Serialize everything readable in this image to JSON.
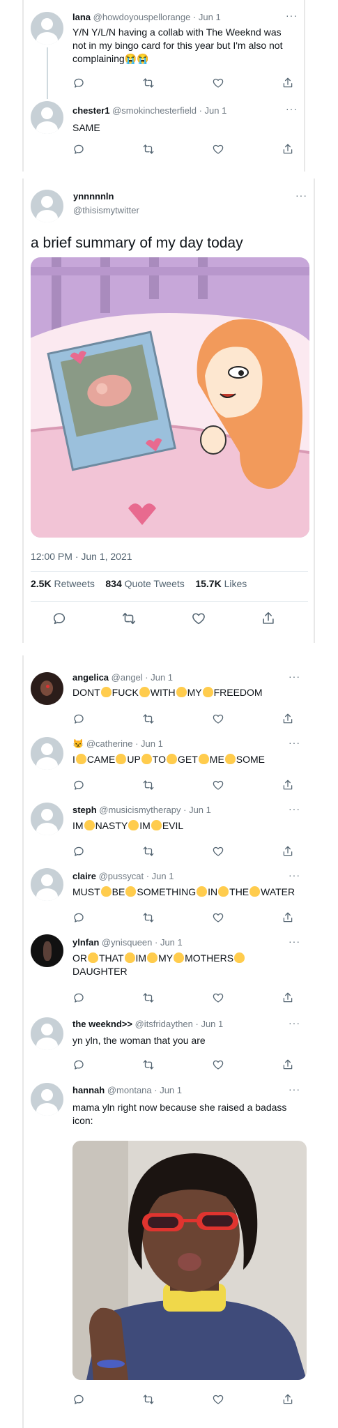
{
  "top_thread": {
    "tweet1": {
      "name": "lana",
      "handle": "@howdoyouspellorange · Jun 1",
      "text": "Y/N Y/L/N having a collab with The Weeknd was not in my bingo card for this year but I'm also not complaining😭😭"
    },
    "tweet2": {
      "name": "chester1",
      "handle": "@smokinchesterfield · Jun 1",
      "text": "SAME"
    }
  },
  "main_tweet": {
    "name": "ynnnnnln",
    "handle": "@thisismytwitter",
    "text": "a brief summary of my day today",
    "timestamp": "12:00 PM · Jun 1, 2021",
    "stats": {
      "retweets_num": "2.5K",
      "retweets_lbl": "Retweets",
      "quotes_num": "834",
      "quotes_lbl": "Quote Tweets",
      "likes_num": "15.7K",
      "likes_lbl": "Likes"
    }
  },
  "replies": [
    {
      "name": "angelica",
      "handle": "@angel · Jun 1",
      "words": [
        "DONT",
        "FUCK",
        "WITH",
        "MY",
        "FREEDOM"
      ]
    },
    {
      "name": "😾",
      "handle": "@catherine · Jun 1",
      "words": [
        "I",
        "CAME",
        "UP",
        "TO",
        "GET",
        "ME",
        "SOME"
      ]
    },
    {
      "name": "steph",
      "handle": "@musicismytherapy · Jun 1",
      "words": [
        "IM",
        "NASTY",
        "IM",
        "EVIL"
      ]
    },
    {
      "name": "claire",
      "handle": "@pussycat · Jun 1",
      "words": [
        "MUST",
        "BE",
        "SOMETHING",
        "IN",
        "THE",
        "WATER"
      ]
    },
    {
      "name": "ylnfan",
      "handle": "@ynisqueen · Jun 1",
      "words": [
        "OR",
        "THAT",
        "IM",
        "MY",
        "MOTHERS",
        "DAUGHTER"
      ]
    },
    {
      "name": "the weeknd>>",
      "handle": "@itsfridaythen · Jun 1",
      "text": "yn yln, the woman that you are"
    },
    {
      "name": "hannah",
      "handle": "@montana · Jun 1",
      "text": "mama yln right now because she raised a badass icon:"
    }
  ],
  "colors": {
    "text": "#0f1419",
    "muted": "#536471",
    "avatar_placeholder": "#c7d0d6",
    "clap": "#ffcc4d",
    "pink": "#f2c4d6"
  },
  "icons": [
    "reply-icon",
    "retweet-icon",
    "like-icon",
    "share-icon",
    "more-icon",
    "clapping-hands-emoji"
  ]
}
